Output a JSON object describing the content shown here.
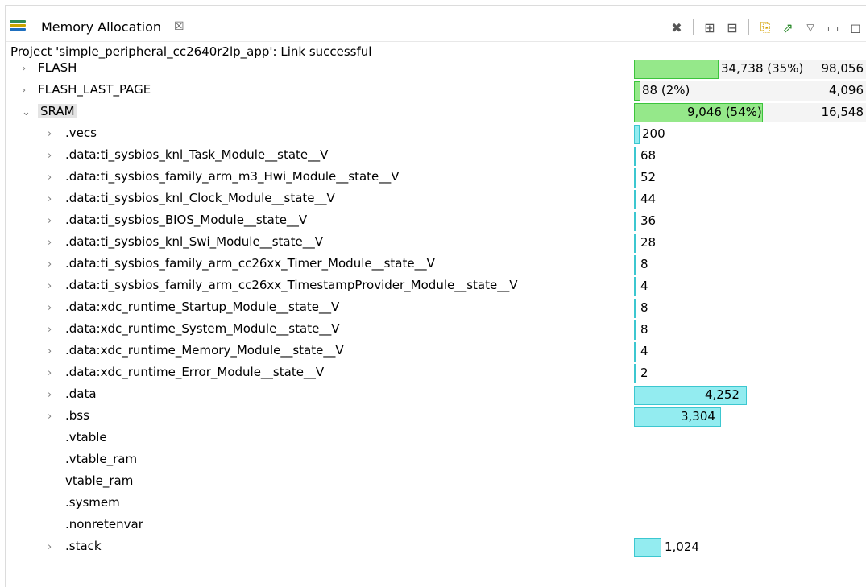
{
  "tab": {
    "title": "Memory Allocation",
    "close": "☒"
  },
  "toolbar": {
    "icons": [
      "close-all-icon",
      "expand-all-icon",
      "collapse-all-icon",
      "new-file-icon",
      "export-icon",
      "view-menu-icon",
      "minimize-icon",
      "maximize-icon"
    ]
  },
  "status": "Project 'simple_peripheral_cc2640r2lp_app': Link successful",
  "rows": [
    {
      "name": "FLASH",
      "value": "34,738 (35%)",
      "total": "98,056"
    },
    {
      "name": "FLASH_LAST_PAGE",
      "value": "88 (2%)",
      "total": "4,096"
    },
    {
      "name": "SRAM",
      "value": "9,046 (54%)",
      "total": "16,548"
    },
    {
      "name": ".vecs",
      "value": "200"
    },
    {
      "name": ".data:ti_sysbios_knl_Task_Module__state__V",
      "value": "68"
    },
    {
      "name": ".data:ti_sysbios_family_arm_m3_Hwi_Module__state__V",
      "value": "52"
    },
    {
      "name": ".data:ti_sysbios_knl_Clock_Module__state__V",
      "value": "44"
    },
    {
      "name": ".data:ti_sysbios_BIOS_Module__state__V",
      "value": "36"
    },
    {
      "name": ".data:ti_sysbios_knl_Swi_Module__state__V",
      "value": "28"
    },
    {
      "name": ".data:ti_sysbios_family_arm_cc26xx_Timer_Module__state__V",
      "value": "8"
    },
    {
      "name": ".data:ti_sysbios_family_arm_cc26xx_TimestampProvider_Module__state__V",
      "value": "4"
    },
    {
      "name": ".data:xdc_runtime_Startup_Module__state__V",
      "value": "8"
    },
    {
      "name": ".data:xdc_runtime_System_Module__state__V",
      "value": "8"
    },
    {
      "name": ".data:xdc_runtime_Memory_Module__state__V",
      "value": "4"
    },
    {
      "name": ".data:xdc_runtime_Error_Module__state__V",
      "value": "2"
    },
    {
      "name": ".data",
      "value": "4,252"
    },
    {
      "name": ".bss",
      "value": "3,304"
    },
    {
      "name": ".vtable"
    },
    {
      "name": ".vtable_ram"
    },
    {
      "name": "vtable_ram"
    },
    {
      "name": ".sysmem"
    },
    {
      "name": ".nonretenvar"
    },
    {
      "name": ".stack",
      "value": "1,024"
    }
  ],
  "colors": {
    "green": "#95e88a",
    "cyan": "#93ecf0"
  }
}
